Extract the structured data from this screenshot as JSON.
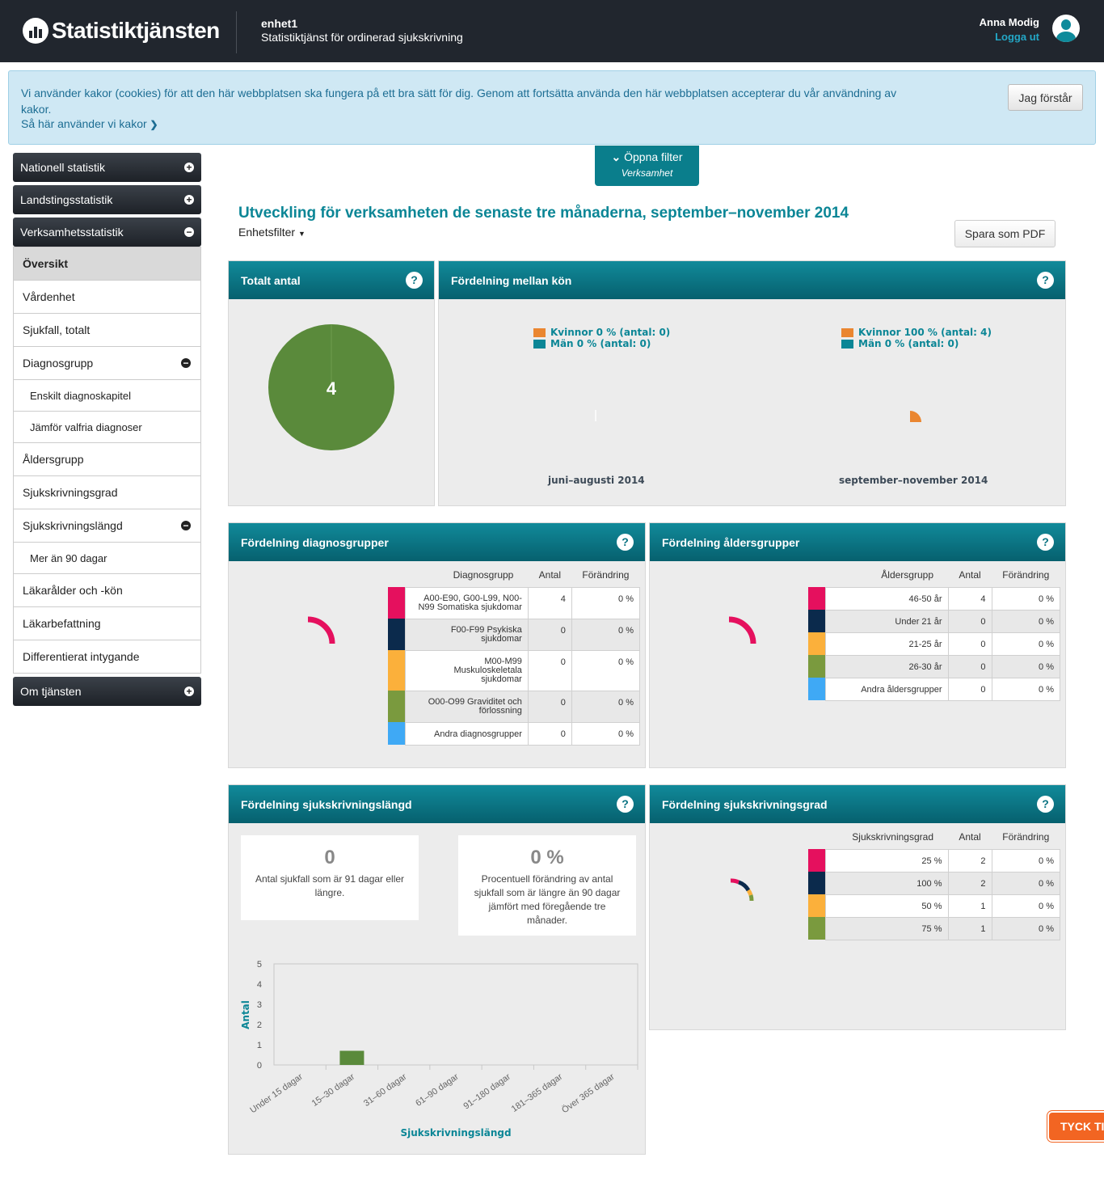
{
  "header": {
    "logo_text": "Statistiktjänsten",
    "unit_name": "enhet1",
    "unit_subtitle": "Statistiktjänst för ordinerad sjukskrivning",
    "user_name": "Anna Modig",
    "logout_label": "Logga ut"
  },
  "cookie": {
    "text": "Vi använder kakor (cookies) för att den här webbplatsen ska fungera på ett bra sätt för dig. Genom att fortsätta använda den här webbplatsen accepterar du vår användning av kakor.",
    "link_label": "Så här använder vi kakor",
    "accept_label": "Jag förstår"
  },
  "sidebar": {
    "national": "Nationell statistik",
    "county": "Landstingsstatistik",
    "business": "Verksamhetsstatistik",
    "items": [
      "Översikt",
      "Vårdenhet",
      "Sjukfall, totalt",
      "Diagnosgrupp",
      "Enskilt diagnoskapitel",
      "Jämför valfria diagnoser",
      "Åldersgrupp",
      "Sjukskrivningsgrad",
      "Sjukskrivningslängd",
      "Mer än 90 dagar",
      "Läkarålder och -kön",
      "Läkarbefattning",
      "Differentierat intygande"
    ],
    "about": "Om tjänsten"
  },
  "filter": {
    "label": "Öppna filter",
    "sublabel": "Verksamhet"
  },
  "page": {
    "title": "Utveckling för verksamheten de senaste tre månaderna, september–november 2014",
    "unit_filter": "Enhetsfilter",
    "pdf_label": "Spara som PDF"
  },
  "panels": {
    "total": {
      "title": "Totalt antal",
      "value": "4",
      "color": "#5a8a3b"
    },
    "gender": {
      "title": "Fördelning mellan kön",
      "periods": [
        {
          "label": "juni–augusti 2014",
          "women": "Kvinnor 0 % (antal: 0)",
          "men": "Män 0 % (antal: 0)"
        },
        {
          "label": "september–november 2014",
          "women": "Kvinnor 100 % (antal: 4)",
          "men": "Män 0 % (antal: 0)"
        }
      ],
      "colors": {
        "women": "#ea8630",
        "men": "#0b8696"
      }
    },
    "diagnosis": {
      "title": "Fördelning diagnosgrupper",
      "columns": [
        "Diagnosgrupp",
        "Antal",
        "Förändring"
      ],
      "rows": [
        {
          "name": "A00-E90, G00-L99, N00-N99 Somatiska sjukdomar",
          "count": "4",
          "change": "0 %",
          "color": "#e5105e"
        },
        {
          "name": "F00-F99 Psykiska sjukdomar",
          "count": "0",
          "change": "0 %",
          "color": "#0b2a4c"
        },
        {
          "name": "M00-M99 Muskuloskeletala sjukdomar",
          "count": "0",
          "change": "0 %",
          "color": "#fbb03b"
        },
        {
          "name": "O00-O99 Graviditet och förlossning",
          "count": "0",
          "change": "0 %",
          "color": "#7a9a3e"
        },
        {
          "name": "Andra diagnosgrupper",
          "count": "0",
          "change": "0 %",
          "color": "#3fa9f5"
        }
      ]
    },
    "age": {
      "title": "Fördelning åldersgrupper",
      "columns": [
        "Åldersgrupp",
        "Antal",
        "Förändring"
      ],
      "rows": [
        {
          "name": "46-50 år",
          "count": "4",
          "change": "0 %",
          "color": "#e5105e"
        },
        {
          "name": "Under 21 år",
          "count": "0",
          "change": "0 %",
          "color": "#0b2a4c"
        },
        {
          "name": "21-25 år",
          "count": "0",
          "change": "0 %",
          "color": "#fbb03b"
        },
        {
          "name": "26-30 år",
          "count": "0",
          "change": "0 %",
          "color": "#7a9a3e"
        },
        {
          "name": "Andra åldersgrupper",
          "count": "0",
          "change": "0 %",
          "color": "#3fa9f5"
        }
      ]
    },
    "length": {
      "title": "Fördelning sjukskrivningslängd",
      "box1_value": "0",
      "box1_text": "Antal sjukfall som är 91 dagar eller längre.",
      "box2_value": "0 %",
      "box2_text": "Procentuell förändring av antal sjukfall som är längre än 90 dagar jämfört med föregående tre månader."
    },
    "degree": {
      "title": "Fördelning sjukskrivningsgrad",
      "columns": [
        "Sjukskrivningsgrad",
        "Antal",
        "Förändring"
      ],
      "rows": [
        {
          "name": "25 %",
          "count": "2",
          "change": "0 %",
          "color": "#e5105e"
        },
        {
          "name": "100 %",
          "count": "2",
          "change": "0 %",
          "color": "#0b2a4c"
        },
        {
          "name": "50 %",
          "count": "1",
          "change": "0 %",
          "color": "#fbb03b"
        },
        {
          "name": "75 %",
          "count": "1",
          "change": "0 %",
          "color": "#7a9a3e"
        }
      ]
    }
  },
  "chart_data": {
    "type": "bar",
    "categories": [
      "Under 15 dagar",
      "15–30 dagar",
      "31–60 dagar",
      "61–90 dagar",
      "91–180 dagar",
      "181–365 dagar",
      "Över 365 dagar"
    ],
    "values": [
      0,
      0.7,
      0,
      0,
      0,
      0,
      0
    ],
    "xlabel": "Sjukskrivningslängd",
    "ylabel": "Antal",
    "ylim": [
      0,
      5
    ],
    "yticks": [
      "0",
      "1",
      "2",
      "3",
      "4",
      "5"
    ],
    "grid": false,
    "color": "#5a8a3b"
  },
  "feedback_label": "TYCK TI"
}
